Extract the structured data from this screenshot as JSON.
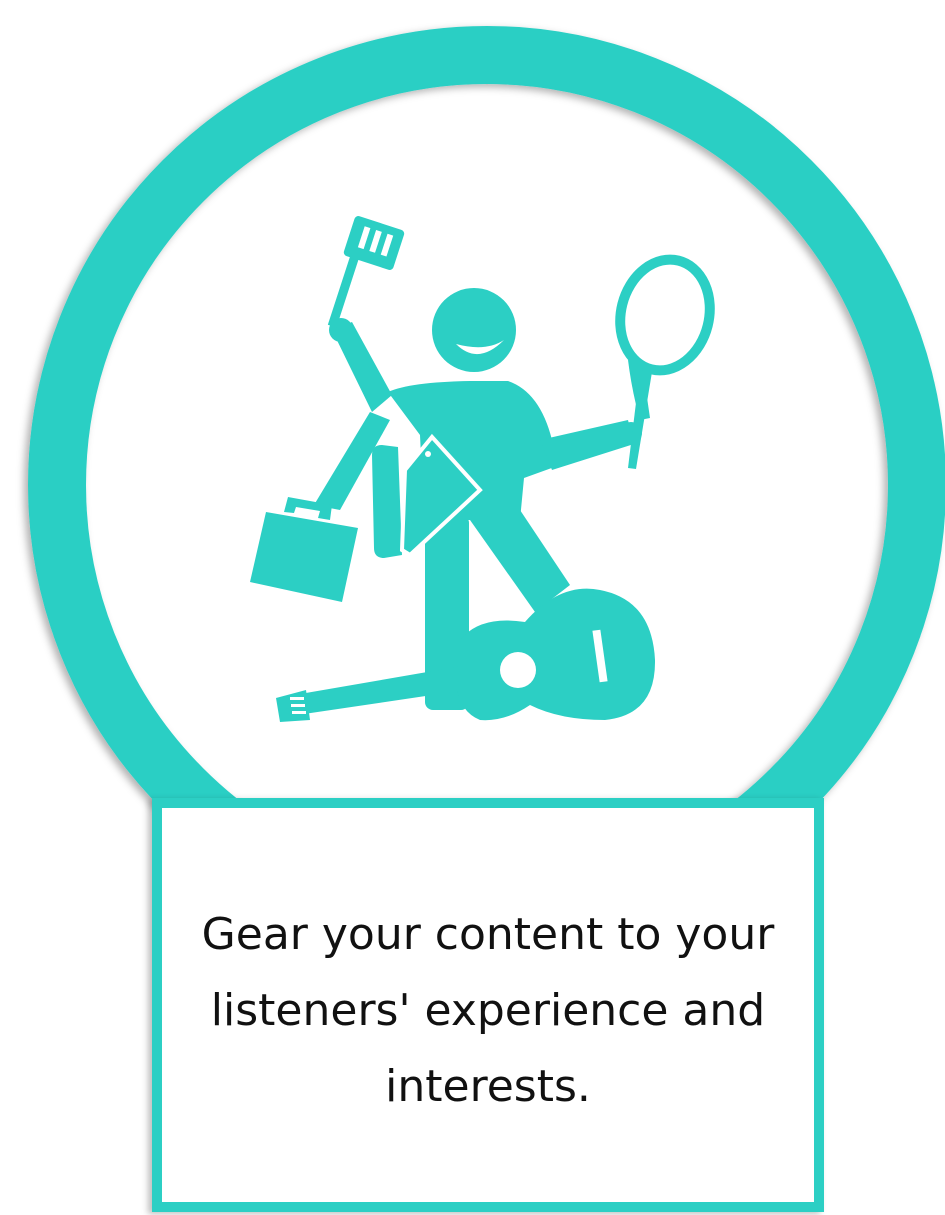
{
  "caption": {
    "text": "Gear your content to your listeners' experience and interests."
  },
  "illustration": {
    "icon": "multitasking-person-icon",
    "props": [
      "spatula-icon",
      "briefcase-icon",
      "tablet-icon",
      "tennis-racket-icon",
      "guitar-icon"
    ]
  },
  "colors": {
    "accent": "#2ccfc4",
    "background": "#ffffff",
    "text": "#111111"
  }
}
